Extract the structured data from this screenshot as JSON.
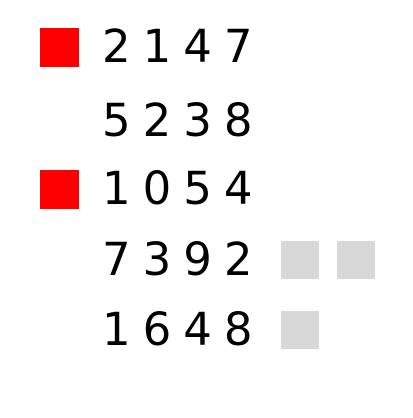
{
  "rows": [
    {
      "digits": "2147",
      "marker": true,
      "extra_squares": 0
    },
    {
      "digits": "5238",
      "marker": false,
      "extra_squares": 0
    },
    {
      "digits": "1054",
      "marker": true,
      "extra_squares": 0
    },
    {
      "digits": "7392",
      "marker": false,
      "extra_squares": 2
    },
    {
      "digits": "1648",
      "marker": false,
      "extra_squares": 1
    }
  ],
  "colors": {
    "marker": "#ff0000",
    "extra_square": "#d8d8d8",
    "text": "#000000",
    "background": "#ffffff"
  }
}
